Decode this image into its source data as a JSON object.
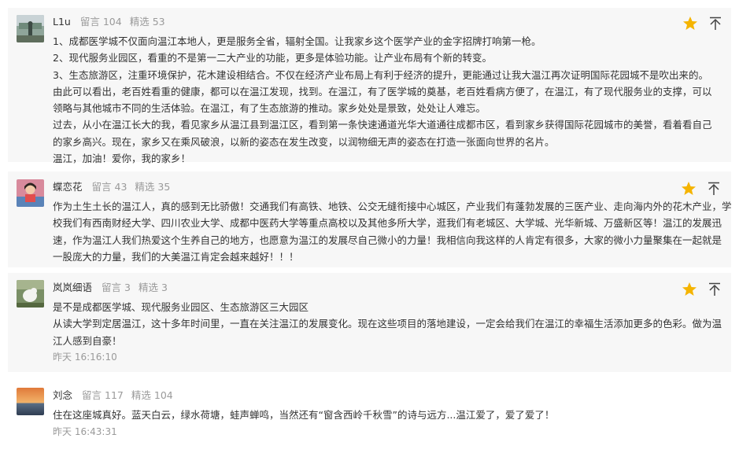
{
  "comments": [
    {
      "username": "L1u",
      "posts_label": "留言",
      "posts_count": "104",
      "featured_label": "精选",
      "featured_count": "53",
      "lines": [
        "1、成都医学城不仅面向温江本地人，更是服务全省，辐射全国。让我家乡这个医学产业的金字招牌打响第一枪。",
        "2、现代服务业园区，看重的不是第一二大产业的功能，更多是体验功能。让产业布局有个新的转变。",
        "3、生态旅游区，注重环境保护，花木建设相结合。不仅在经济产业布局上有利于经济的提升，更能通过让我大温江再次证明国际花园城不是吹出来的。",
        "    由此可以看出，老百姓看重的健康，都可以在温江发现，找到。在温江，有了医学城的奠基，老百姓看病方便了，在温江，有了现代服务业的支撑，可以",
        "领略与其他城市不同的生活体验。在温江，有了生态旅游的推动。家乡处处是景致，处处让人难忘。",
        "    过去，从小在温江长大的我，看见家乡从温江县到温江区，看到第一条快速通道光华大道通往成都市区，看到家乡获得国际花园城市的美誉，看着看自己",
        "的家乡高兴。现在，家乡又在乘风破浪，以新的姿态在发生改变，以润物细无声的姿态在打造一张面向世界的名片。",
        "    温江，加油！爱你，我的家乡！"
      ]
    },
    {
      "username": "蝶恋花",
      "posts_label": "留言",
      "posts_count": "43",
      "featured_label": "精选",
      "featured_count": "35",
      "lines": [
        "作为土生土长的温江人，真的感到无比骄傲！交通我们有高铁、地铁、公交无缝衔接中心城区，产业我们有蓬勃发展的三医产业、走向海内外的花木产业，学",
        "校我们有西南财经大学、四川农业大学、成都中医药大学等重点高校以及其他多所大学，逛我们有老城区、大学城、光华新城、万盛新区等！温江的发展迅",
        "速，作为温江人我们热爱这个生养自己的地方，也愿意为温江的发展尽自己微小的力量！我相信向我这样的人肯定有很多，大家的微小力量聚集在一起就是",
        "一股庞大的力量，我们的大美温江肯定会越来越好！！！"
      ]
    },
    {
      "username": "岚岚细语",
      "posts_label": "留言",
      "posts_count": "3",
      "featured_label": "精选",
      "featured_count": "3",
      "lines": [
        "是不是成都医学城、现代服务业园区、生态旅游区三大园区",
        "从读大学到定居温江，这十多年时间里，一直在关注温江的发展变化。现在这些项目的落地建设，一定会给我们在温江的幸福生活添加更多的色彩。做为温",
        "江人感到自豪！"
      ],
      "time": "昨天 16:16:10"
    },
    {
      "username": "刘念",
      "posts_label": "留言",
      "posts_count": "117",
      "featured_label": "精选",
      "featured_count": "104",
      "lines": [
        "住在这座城真好。蓝天白云，绿水荷塘，蛙声蝉鸣，当然还有“窗含西岭千秋雪”的诗与远方...温江爱了，爱了爱了！"
      ],
      "time": "昨天 16:43:31"
    }
  ],
  "colors": {
    "card_bg": "#f7f7f7",
    "meta_gray": "#9a9a9a",
    "text": "#333333",
    "star": "#f5b400"
  },
  "icons": {
    "star": "star-icon",
    "pin_top": "pin-to-top-icon"
  }
}
